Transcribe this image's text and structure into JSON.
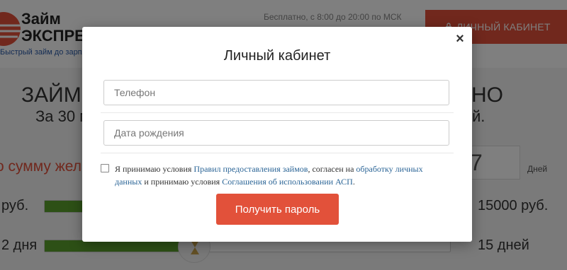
{
  "header": {
    "logo_line1": "Займ",
    "logo_line2": "ЭКСПРЕСС",
    "tagline": "Быстрый займ до зарплаты",
    "hours": "Бесплатно, с 8:00 до 20:00 по МСК",
    "cabinet_button": "ЛИЧНЫЙ КАБИНЕТ",
    "cabinet_icon": "lock-icon"
  },
  "hero": {
    "title_left": "ЗАЙМ",
    "title_right": "НО",
    "subtitle_left": "За 30 м",
    "subtitle_right": "й.",
    "amount_prompt": "о сумму жел",
    "days_value": "7",
    "days_label": "Дней"
  },
  "sliders": {
    "amount": {
      "min_label": "руб.",
      "max_label": "15000 руб.",
      "fill_fraction": 0.27
    },
    "days": {
      "min_label": "2 дня",
      "max_label": "15 дней",
      "fill_fraction": 0.37,
      "knob_icon": "hourglass-icon"
    }
  },
  "modal": {
    "title": "Личный кабинет",
    "close_symbol": "×",
    "phone_placeholder": "Телефон",
    "dob_placeholder": "Дата рождения",
    "consent": {
      "part1": "Я принимаю условия ",
      "link1": "Правил предоставления займов",
      "part2": ", согласен на ",
      "link2": "обработку личных данных",
      "part3": " и принимаю условия ",
      "link3": "Соглашения об использовании АСП",
      "part4": "."
    },
    "submit_label": "Получить пароль"
  },
  "colors": {
    "accent": "#e2513a",
    "slider_fill": "#5aa02c",
    "link": "#2a6496",
    "overlay": "rgba(0,0,0,0.5)"
  }
}
